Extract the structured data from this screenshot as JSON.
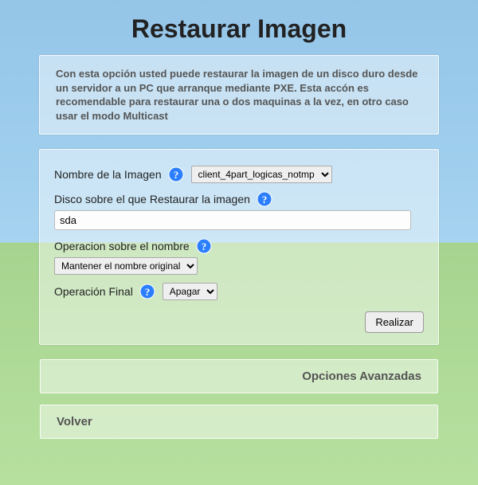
{
  "title": "Restaurar Imagen",
  "description": "Con esta opción usted puede restaurar la imagen de un disco duro desde un servidor a un PC que arranque mediante PXE. Esta accón es recomendable para restaurar una o dos maquinas a la vez, en otro caso usar el modo Multicast",
  "form": {
    "image_name": {
      "label": "Nombre de la Imagen",
      "value": "client_4part_logicas_notmp"
    },
    "target_disk": {
      "label": "Disco sobre el que Restaurar la imagen",
      "value": "sda"
    },
    "name_operation": {
      "label": "Operacion sobre el nombre",
      "value": "Mantener el nombre original"
    },
    "final_operation": {
      "label": "Operación Final",
      "value": "Apagar"
    },
    "submit": "Realizar"
  },
  "footer": {
    "advanced": "Opciones Avanzadas",
    "back": "Volver"
  }
}
